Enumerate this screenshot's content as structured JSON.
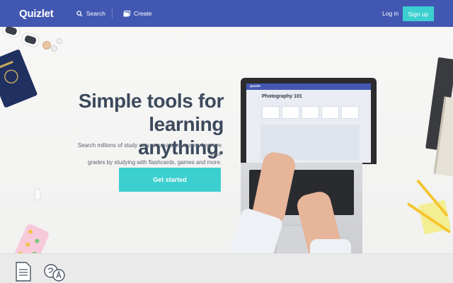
{
  "nav": {
    "logo": "Quizlet",
    "search_label": "Search",
    "create_label": "Create",
    "login_label": "Log in",
    "signup_label": "Sign up"
  },
  "hero": {
    "title_line1": "Simple tools for",
    "title_line2": "learning anything.",
    "subtitle_line1": "Search millions of study sets or create your own. Improve your",
    "subtitle_line2": "grades by studying with flashcards, games and more.",
    "cta_label": "Get started"
  },
  "laptop_screen": {
    "app_logo": "Quizlet",
    "set_title": "Photography 101"
  },
  "colors": {
    "nav_bg": "#4257b2",
    "accent": "#3ccfcf",
    "title_text": "#3c4a5c"
  },
  "icons": [
    "search-icon",
    "create-icon",
    "document-icon",
    "translate-icon"
  ]
}
